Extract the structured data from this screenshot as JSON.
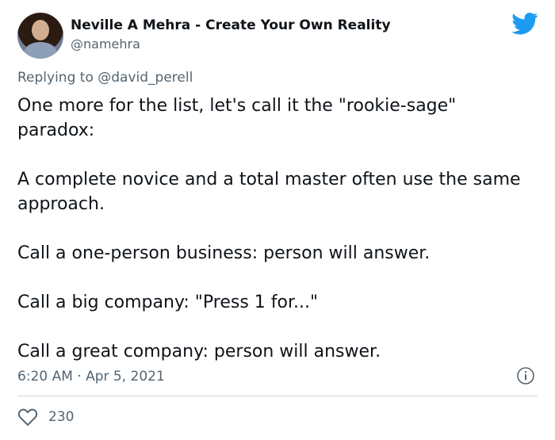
{
  "author": {
    "display_name": "Neville A Mehra - Create Your Own Reality",
    "handle": "@namehra",
    "avatar": "profile-photo"
  },
  "reply": {
    "prefix": "Replying to ",
    "mention": "@david_perell"
  },
  "tweet": {
    "paragraphs": [
      "One more for the list, let's call it the \"rookie-sage\" paradox:",
      "A complete novice and a total master often use the same approach.",
      "Call a one-person business: person will answer.",
      "Call a big company: \"Press 1 for...\"",
      "Call a great company: person will answer."
    ],
    "timestamp": "6:20 AM · Apr 5, 2021"
  },
  "engagement": {
    "like_count": "230"
  },
  "colors": {
    "brand": "#1d9bf0",
    "muted": "#536471",
    "text": "#0f1419",
    "divider": "#cfd9de"
  },
  "icons": {
    "brand": "twitter-bird-icon",
    "info": "info-icon",
    "like": "heart-icon"
  }
}
